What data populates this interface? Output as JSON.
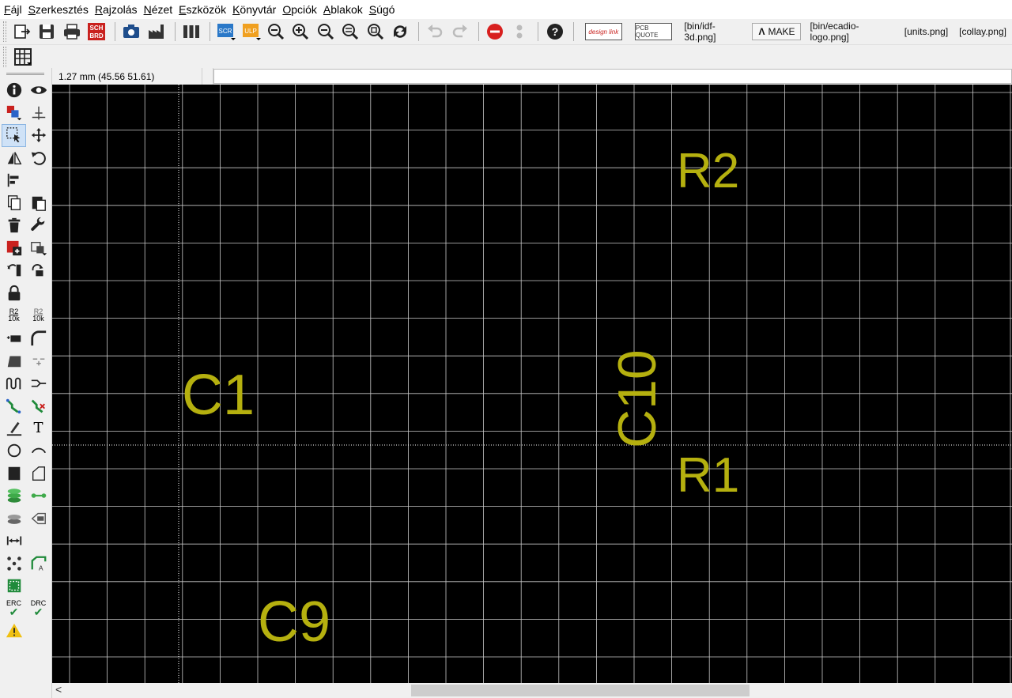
{
  "menu": [
    {
      "u": "F",
      "rest": "ájl"
    },
    {
      "u": "S",
      "rest": "zerkesztés"
    },
    {
      "u": "R",
      "rest": "ajzolás"
    },
    {
      "u": "N",
      "rest": "ézet"
    },
    {
      "u": "E",
      "rest": "szközök"
    },
    {
      "u": "K",
      "rest": "önyvtár"
    },
    {
      "u": "O",
      "rest": "pciók"
    },
    {
      "u": "A",
      "rest": "blakok"
    },
    {
      "u": "S",
      "rest": "úgó"
    }
  ],
  "toolbar": {
    "sch_brd_label_top": "SCH",
    "sch_brd_label_bottom": "BRD",
    "scr_label": "SCR",
    "ulp_label": "ULP",
    "design_link_label": "design link",
    "pcb_quote_label": "PCB QUOTE",
    "idf_btn": "[bin/idf-3d.png]",
    "make_btn": "MAKE",
    "ecadio_btn": "[bin/ecadio-logo.png]",
    "units_btn": "[units.png]",
    "collay_btn": "[collay.png]"
  },
  "left_toolbar": {
    "value_label": "R2",
    "value_sub": "10k",
    "erc_label": "ERC",
    "drc_label": "DRC",
    "text_tool": "T"
  },
  "status": {
    "coordinates": "1.27 mm (45.56 51.61)"
  },
  "board": {
    "background": "#000000",
    "grid_color": "#c8c8c8",
    "label_color": "#b5b00f",
    "parts": [
      {
        "name": "R2",
        "rotated": false
      },
      {
        "name": "C1",
        "rotated": false
      },
      {
        "name": "C10",
        "rotated": true
      },
      {
        "name": "R1",
        "rotated": false
      },
      {
        "name": "C9",
        "rotated": false
      }
    ]
  }
}
